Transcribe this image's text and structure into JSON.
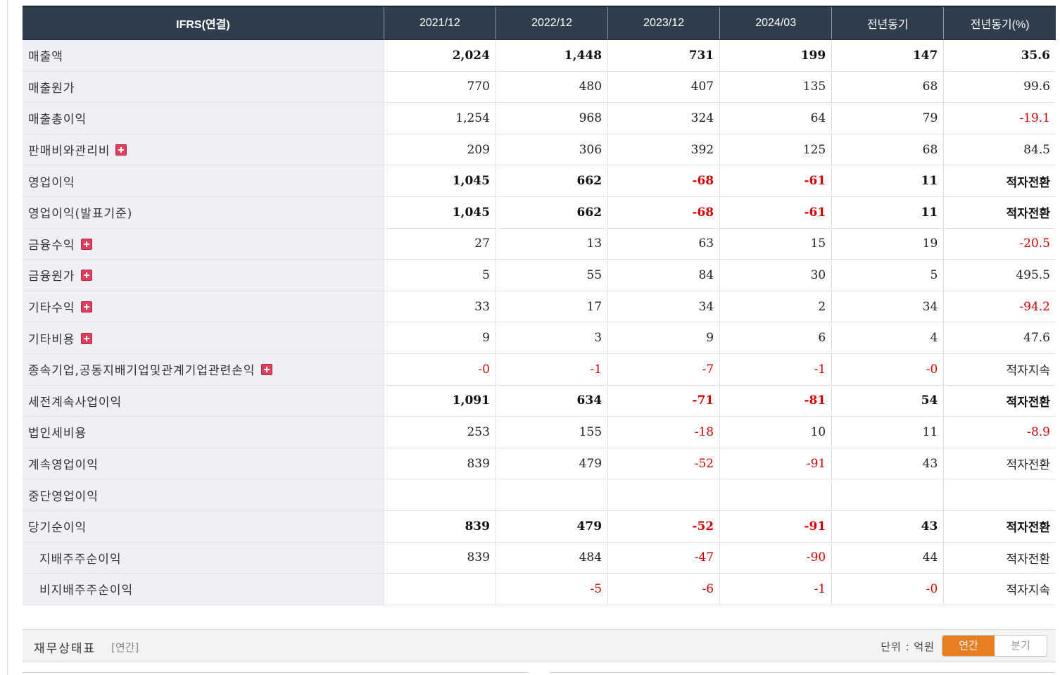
{
  "income_table": {
    "columns": [
      "IFRS(연결)",
      "2021/12",
      "2022/12",
      "2023/12",
      "2024/03",
      "전년동기",
      "전년동기(%)"
    ],
    "rows": [
      {
        "label": "매출액",
        "bold": true,
        "expandable": false,
        "sub": false,
        "separator": false,
        "values": [
          {
            "v": "2,024",
            "neg": false
          },
          {
            "v": "1,448",
            "neg": false
          },
          {
            "v": "731",
            "neg": false
          },
          {
            "v": "199",
            "neg": false
          },
          {
            "v": "147",
            "neg": false
          },
          {
            "v": "35.6",
            "neg": false
          }
        ]
      },
      {
        "label": "매출원가",
        "bold": false,
        "expandable": false,
        "sub": false,
        "separator": false,
        "values": [
          {
            "v": "770",
            "neg": false
          },
          {
            "v": "480",
            "neg": false
          },
          {
            "v": "407",
            "neg": false
          },
          {
            "v": "135",
            "neg": false
          },
          {
            "v": "68",
            "neg": false
          },
          {
            "v": "99.6",
            "neg": false
          }
        ]
      },
      {
        "label": "매출총이익",
        "bold": false,
        "expandable": false,
        "sub": false,
        "separator": false,
        "values": [
          {
            "v": "1,254",
            "neg": false
          },
          {
            "v": "968",
            "neg": false
          },
          {
            "v": "324",
            "neg": false
          },
          {
            "v": "64",
            "neg": false
          },
          {
            "v": "79",
            "neg": false
          },
          {
            "v": "-19.1",
            "neg": true
          }
        ]
      },
      {
        "label": "판매비와관리비",
        "bold": false,
        "expandable": true,
        "sub": false,
        "separator": false,
        "values": [
          {
            "v": "209",
            "neg": false
          },
          {
            "v": "306",
            "neg": false
          },
          {
            "v": "392",
            "neg": false
          },
          {
            "v": "125",
            "neg": false
          },
          {
            "v": "68",
            "neg": false
          },
          {
            "v": "84.5",
            "neg": false
          }
        ]
      },
      {
        "label": "영업이익",
        "bold": true,
        "expandable": false,
        "sub": false,
        "separator": true,
        "values": [
          {
            "v": "1,045",
            "neg": false
          },
          {
            "v": "662",
            "neg": false
          },
          {
            "v": "-68",
            "neg": true
          },
          {
            "v": "-61",
            "neg": true
          },
          {
            "v": "11",
            "neg": false
          },
          {
            "v": "적자전환",
            "neg": false
          }
        ]
      },
      {
        "label": "영업이익(발표기준)",
        "bold": true,
        "expandable": false,
        "sub": false,
        "separator": false,
        "values": [
          {
            "v": "1,045",
            "neg": false
          },
          {
            "v": "662",
            "neg": false
          },
          {
            "v": "-68",
            "neg": true
          },
          {
            "v": "-61",
            "neg": true
          },
          {
            "v": "11",
            "neg": false
          },
          {
            "v": "적자전환",
            "neg": false
          }
        ]
      },
      {
        "label": "금융수익",
        "bold": false,
        "expandable": true,
        "sub": false,
        "separator": true,
        "values": [
          {
            "v": "27",
            "neg": false
          },
          {
            "v": "13",
            "neg": false
          },
          {
            "v": "63",
            "neg": false
          },
          {
            "v": "15",
            "neg": false
          },
          {
            "v": "19",
            "neg": false
          },
          {
            "v": "-20.5",
            "neg": true
          }
        ]
      },
      {
        "label": "금융원가",
        "bold": false,
        "expandable": true,
        "sub": false,
        "separator": false,
        "values": [
          {
            "v": "5",
            "neg": false
          },
          {
            "v": "55",
            "neg": false
          },
          {
            "v": "84",
            "neg": false
          },
          {
            "v": "30",
            "neg": false
          },
          {
            "v": "5",
            "neg": false
          },
          {
            "v": "495.5",
            "neg": false
          }
        ]
      },
      {
        "label": "기타수익",
        "bold": false,
        "expandable": true,
        "sub": false,
        "separator": true,
        "values": [
          {
            "v": "33",
            "neg": false
          },
          {
            "v": "17",
            "neg": false
          },
          {
            "v": "34",
            "neg": false
          },
          {
            "v": "2",
            "neg": false
          },
          {
            "v": "34",
            "neg": false
          },
          {
            "v": "-94.2",
            "neg": true
          }
        ]
      },
      {
        "label": "기타비용",
        "bold": false,
        "expandable": true,
        "sub": false,
        "separator": false,
        "values": [
          {
            "v": "9",
            "neg": false
          },
          {
            "v": "3",
            "neg": false
          },
          {
            "v": "9",
            "neg": false
          },
          {
            "v": "6",
            "neg": false
          },
          {
            "v": "4",
            "neg": false
          },
          {
            "v": "47.6",
            "neg": false
          }
        ]
      },
      {
        "label": "종속기업,공동지배기업및관계기업관련손익",
        "bold": false,
        "expandable": true,
        "sub": false,
        "separator": true,
        "values": [
          {
            "v": "-0",
            "neg": true
          },
          {
            "v": "-1",
            "neg": true
          },
          {
            "v": "-7",
            "neg": true
          },
          {
            "v": "-1",
            "neg": true
          },
          {
            "v": "-0",
            "neg": true
          },
          {
            "v": "적자지속",
            "neg": false
          }
        ]
      },
      {
        "label": "세전계속사업이익",
        "bold": true,
        "expandable": false,
        "sub": false,
        "separator": true,
        "values": [
          {
            "v": "1,091",
            "neg": false
          },
          {
            "v": "634",
            "neg": false
          },
          {
            "v": "-71",
            "neg": true
          },
          {
            "v": "-81",
            "neg": true
          },
          {
            "v": "54",
            "neg": false
          },
          {
            "v": "적자전환",
            "neg": false
          }
        ]
      },
      {
        "label": "법인세비용",
        "bold": false,
        "expandable": false,
        "sub": false,
        "separator": false,
        "values": [
          {
            "v": "253",
            "neg": false
          },
          {
            "v": "155",
            "neg": false
          },
          {
            "v": "-18",
            "neg": true
          },
          {
            "v": "10",
            "neg": false
          },
          {
            "v": "11",
            "neg": false
          },
          {
            "v": "-8.9",
            "neg": true
          }
        ]
      },
      {
        "label": "계속영업이익",
        "bold": false,
        "expandable": false,
        "sub": false,
        "separator": false,
        "values": [
          {
            "v": "839",
            "neg": false
          },
          {
            "v": "479",
            "neg": false
          },
          {
            "v": "-52",
            "neg": true
          },
          {
            "v": "-91",
            "neg": true
          },
          {
            "v": "43",
            "neg": false
          },
          {
            "v": "적자전환",
            "neg": false
          }
        ]
      },
      {
        "label": "중단영업이익",
        "bold": false,
        "expandable": false,
        "sub": false,
        "separator": false,
        "values": [
          {
            "v": "",
            "neg": false
          },
          {
            "v": "",
            "neg": false
          },
          {
            "v": "",
            "neg": false
          },
          {
            "v": "",
            "neg": false
          },
          {
            "v": "",
            "neg": false
          },
          {
            "v": "",
            "neg": false
          }
        ]
      },
      {
        "label": "당기순이익",
        "bold": true,
        "expandable": false,
        "sub": false,
        "separator": false,
        "values": [
          {
            "v": "839",
            "neg": false
          },
          {
            "v": "479",
            "neg": false
          },
          {
            "v": "-52",
            "neg": true
          },
          {
            "v": "-91",
            "neg": true
          },
          {
            "v": "43",
            "neg": false
          },
          {
            "v": "적자전환",
            "neg": false
          }
        ]
      },
      {
        "label": "지배주주순이익",
        "bold": false,
        "expandable": false,
        "sub": true,
        "separator": false,
        "values": [
          {
            "v": "839",
            "neg": false
          },
          {
            "v": "484",
            "neg": false
          },
          {
            "v": "-47",
            "neg": true
          },
          {
            "v": "-90",
            "neg": true
          },
          {
            "v": "44",
            "neg": false
          },
          {
            "v": "적자전환",
            "neg": false
          }
        ]
      },
      {
        "label": "비지배주주순이익",
        "bold": false,
        "expandable": false,
        "sub": true,
        "separator": false,
        "values": [
          {
            "v": "",
            "neg": false
          },
          {
            "v": "-5",
            "neg": true
          },
          {
            "v": "-6",
            "neg": true
          },
          {
            "v": "-1",
            "neg": true
          },
          {
            "v": "-0",
            "neg": true
          },
          {
            "v": "적자지속",
            "neg": false
          }
        ]
      }
    ]
  },
  "balance_section": {
    "title": "재무상태표",
    "period": "[연간]",
    "unit_label": "단위 : 억원",
    "toggle": {
      "annual": "연간",
      "quarter": "분기",
      "active": "annual"
    }
  },
  "colors": {
    "header_bg": "#2f3d4d",
    "label_bg": "#eef0f5",
    "negative": "#d20000",
    "toggle_active": "#e67e22"
  },
  "icons": {
    "expand": "plus-box-icon"
  }
}
